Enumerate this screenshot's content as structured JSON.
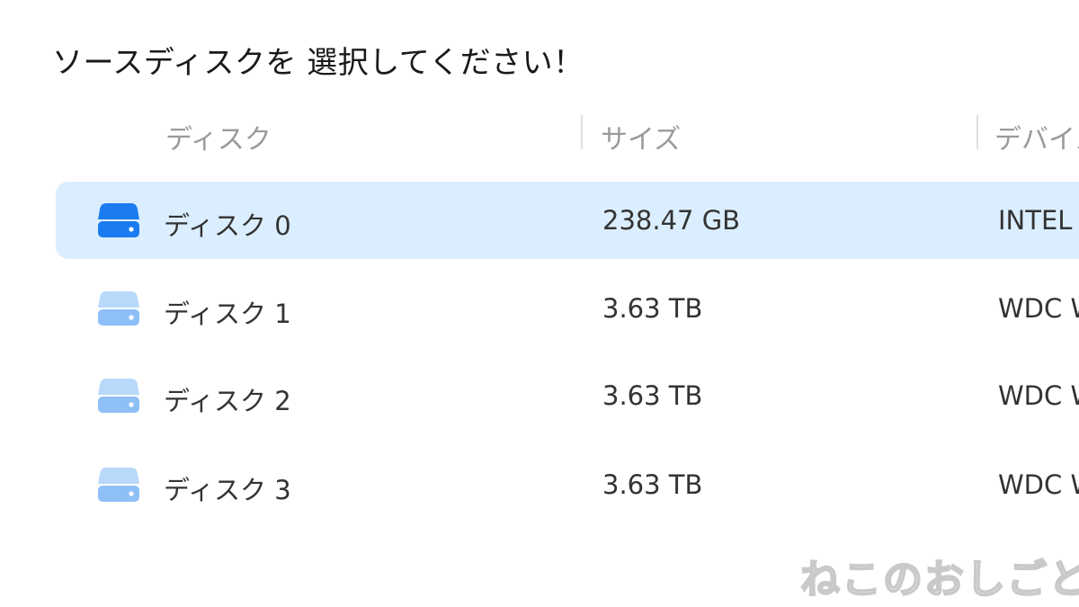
{
  "title": "ソースディスクを 選択してください！",
  "columns": {
    "disk": "ディスク",
    "size": "サイズ",
    "device": "デバイス"
  },
  "rows": [
    {
      "name": "ディスク 0",
      "size": "238.47 GB",
      "device": "INTEL",
      "selected": true,
      "icon": "disk-icon"
    },
    {
      "name": "ディスク 1",
      "size": "3.63 TB",
      "device": "WDC W",
      "selected": false,
      "icon": "disk-icon"
    },
    {
      "name": "ディスク 2",
      "size": "3.63 TB",
      "device": "WDC W",
      "selected": false,
      "icon": "disk-icon"
    },
    {
      "name": "ディスク 3",
      "size": "3.63 TB",
      "device": "WDC W",
      "selected": false,
      "icon": "disk-icon"
    }
  ],
  "colors": {
    "selected_row_bg": "#dbeeff",
    "icon_selected": "#1a7cf0",
    "icon_selected_light": "#5aa3f7",
    "icon_normal": "#8ec0f7",
    "icon_normal_light": "#b9d9fb"
  },
  "watermark": "ねこのおしごと"
}
